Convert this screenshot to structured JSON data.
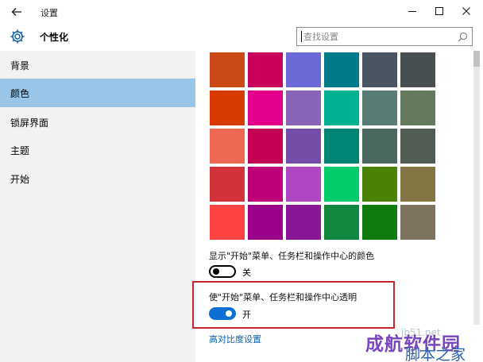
{
  "window": {
    "title": "设置",
    "back_icon": "back-arrow-icon",
    "minimize_icon": "minimize-icon",
    "maximize_icon": "maximize-icon",
    "close_icon": "close-icon"
  },
  "header": {
    "icon": "gear-icon",
    "title": "个性化",
    "search_placeholder": "查找设置",
    "search_icon": "search-icon"
  },
  "sidebar": {
    "items": [
      {
        "label": "背景",
        "selected": false
      },
      {
        "label": "颜色",
        "selected": true
      },
      {
        "label": "锁屏界面",
        "selected": false
      },
      {
        "label": "主题",
        "selected": false
      },
      {
        "label": "开始",
        "selected": false
      }
    ]
  },
  "palette": {
    "rows": [
      [
        "#c94a16",
        "#c8005a",
        "#6b69d6",
        "#007a87",
        "#4a5563",
        "#474f52"
      ],
      [
        "#d83b01",
        "#e3008c",
        "#8764b8",
        "#00b294",
        "#567c73",
        "#647a5f"
      ],
      [
        "#ef6950",
        "#c30052",
        "#744da9",
        "#018574",
        "#486860",
        "#525e54"
      ],
      [
        "#d13438",
        "#bf0077",
        "#b146c2",
        "#00cc6a",
        "#498205",
        "#847545"
      ],
      [
        "#ff4343",
        "#9a0089",
        "#881798",
        "#10893e",
        "#107c10",
        "#7e735f"
      ]
    ]
  },
  "options": {
    "show_color": {
      "label": "显示\"开始\"菜单、任务栏和操作中心的颜色",
      "state": "关",
      "on": false
    },
    "transparency": {
      "label": "使\"开始\"菜单、任务栏和操作中心透明",
      "state": "开",
      "on": true
    }
  },
  "link": {
    "label": "高对比度设置"
  },
  "watermark": {
    "faint": "jb51.net",
    "main": "成航软件园",
    "sub": "脚本之家"
  },
  "colors": {
    "accent": "#0b6fd3",
    "sidebar_selected": "#99c6e8",
    "highlight": "#c0282a"
  }
}
